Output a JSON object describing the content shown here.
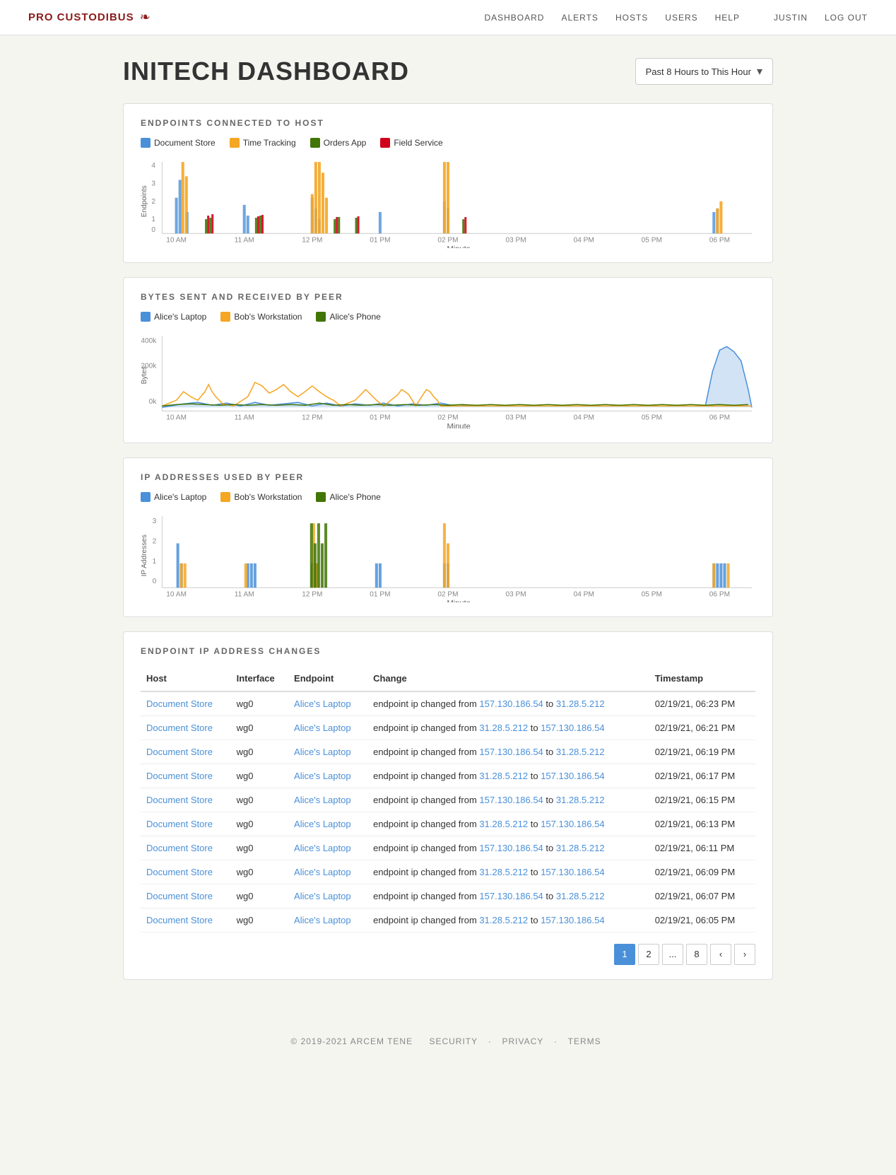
{
  "nav": {
    "logo": "PRO CUSTODIBUS",
    "links": [
      "DASHBOARD",
      "ALERTS",
      "HOSTS",
      "USERS",
      "HELP"
    ],
    "user": "JUSTIN",
    "logout": "LOG OUT"
  },
  "header": {
    "title": "INITECH DASHBOARD",
    "time_selector": "Past 8 Hours to This Hour"
  },
  "charts": {
    "endpoints": {
      "title": "ENDPOINTS CONNECTED TO HOST",
      "legend": [
        {
          "label": "Document Store",
          "color": "#4a90d9"
        },
        {
          "label": "Time Tracking",
          "color": "#f5a623"
        },
        {
          "label": "Orders App",
          "color": "#417505"
        },
        {
          "label": "Field Service",
          "color": "#d0021b"
        }
      ],
      "x_label": "Minute",
      "y_label": "Endpoints",
      "x_ticks": [
        "10 AM",
        "11 AM",
        "12 PM",
        "01 PM",
        "02 PM",
        "03 PM",
        "04 PM",
        "05 PM",
        "06 PM"
      ]
    },
    "bytes": {
      "title": "BYTES SENT AND RECEIVED BY PEER",
      "legend": [
        {
          "label": "Alice's Laptop",
          "color": "#4a90d9"
        },
        {
          "label": "Bob's Workstation",
          "color": "#f5a623"
        },
        {
          "label": "Alice's Phone",
          "color": "#417505"
        }
      ],
      "x_label": "Minute",
      "y_label": "Bytes",
      "x_ticks": [
        "10 AM",
        "11 AM",
        "12 PM",
        "01 PM",
        "02 PM",
        "03 PM",
        "04 PM",
        "05 PM",
        "06 PM"
      ],
      "y_ticks": [
        "400k",
        "200k",
        "0k"
      ]
    },
    "ip_addresses": {
      "title": "IP ADDRESSES USED BY PEER",
      "legend": [
        {
          "label": "Alice's Laptop",
          "color": "#4a90d9"
        },
        {
          "label": "Bob's Workstation",
          "color": "#f5a623"
        },
        {
          "label": "Alice's Phone",
          "color": "#417505"
        }
      ],
      "x_label": "Minute",
      "y_label": "IP Addresses",
      "x_ticks": [
        "10 AM",
        "11 AM",
        "12 PM",
        "01 PM",
        "02 PM",
        "03 PM",
        "04 PM",
        "05 PM",
        "06 PM"
      ],
      "y_ticks": [
        "3",
        "2",
        "1",
        "0"
      ]
    }
  },
  "ip_changes": {
    "title": "ENDPOINT IP ADDRESS CHANGES",
    "columns": [
      "Host",
      "Interface",
      "Endpoint",
      "Change",
      "Timestamp"
    ],
    "rows": [
      {
        "host": "Document Store",
        "interface": "wg0",
        "endpoint": "Alice's Laptop",
        "change_text": "endpoint ip changed from ",
        "ip1": "157.130.186.54",
        "to_text": " to ",
        "ip2": "31.28.5.212",
        "timestamp": "02/19/21, 06:23 PM"
      },
      {
        "host": "Document Store",
        "interface": "wg0",
        "endpoint": "Alice's Laptop",
        "change_text": "endpoint ip changed from ",
        "ip1": "31.28.5.212",
        "to_text": " to ",
        "ip2": "157.130.186.54",
        "timestamp": "02/19/21, 06:21 PM"
      },
      {
        "host": "Document Store",
        "interface": "wg0",
        "endpoint": "Alice's Laptop",
        "change_text": "endpoint ip changed from ",
        "ip1": "157.130.186.54",
        "to_text": " to ",
        "ip2": "31.28.5.212",
        "timestamp": "02/19/21, 06:19 PM"
      },
      {
        "host": "Document Store",
        "interface": "wg0",
        "endpoint": "Alice's Laptop",
        "change_text": "endpoint ip changed from ",
        "ip1": "31.28.5.212",
        "to_text": " to ",
        "ip2": "157.130.186.54",
        "timestamp": "02/19/21, 06:17 PM"
      },
      {
        "host": "Document Store",
        "interface": "wg0",
        "endpoint": "Alice's Laptop",
        "change_text": "endpoint ip changed from ",
        "ip1": "157.130.186.54",
        "to_text": " to ",
        "ip2": "31.28.5.212",
        "timestamp": "02/19/21, 06:15 PM"
      },
      {
        "host": "Document Store",
        "interface": "wg0",
        "endpoint": "Alice's Laptop",
        "change_text": "endpoint ip changed from ",
        "ip1": "31.28.5.212",
        "to_text": " to ",
        "ip2": "157.130.186.54",
        "timestamp": "02/19/21, 06:13 PM"
      },
      {
        "host": "Document Store",
        "interface": "wg0",
        "endpoint": "Alice's Laptop",
        "change_text": "endpoint ip changed from ",
        "ip1": "157.130.186.54",
        "to_text": " to ",
        "ip2": "31.28.5.212",
        "timestamp": "02/19/21, 06:11 PM"
      },
      {
        "host": "Document Store",
        "interface": "wg0",
        "endpoint": "Alice's Laptop",
        "change_text": "endpoint ip changed from ",
        "ip1": "31.28.5.212",
        "to_text": " to ",
        "ip2": "157.130.186.54",
        "timestamp": "02/19/21, 06:09 PM"
      },
      {
        "host": "Document Store",
        "interface": "wg0",
        "endpoint": "Alice's Laptop",
        "change_text": "endpoint ip changed from ",
        "ip1": "157.130.186.54",
        "to_text": " to ",
        "ip2": "31.28.5.212",
        "timestamp": "02/19/21, 06:07 PM"
      },
      {
        "host": "Document Store",
        "interface": "wg0",
        "endpoint": "Alice's Laptop",
        "change_text": "endpoint ip changed from ",
        "ip1": "31.28.5.212",
        "to_text": " to ",
        "ip2": "157.130.186.54",
        "timestamp": "02/19/21, 06:05 PM"
      }
    ]
  },
  "pagination": {
    "current": 1,
    "pages": [
      "1",
      "2",
      "...",
      "8"
    ]
  },
  "footer": {
    "copyright": "© 2019-2021 ARCEM TENE",
    "links": [
      "SECURITY",
      "PRIVACY",
      "TERMS"
    ]
  }
}
